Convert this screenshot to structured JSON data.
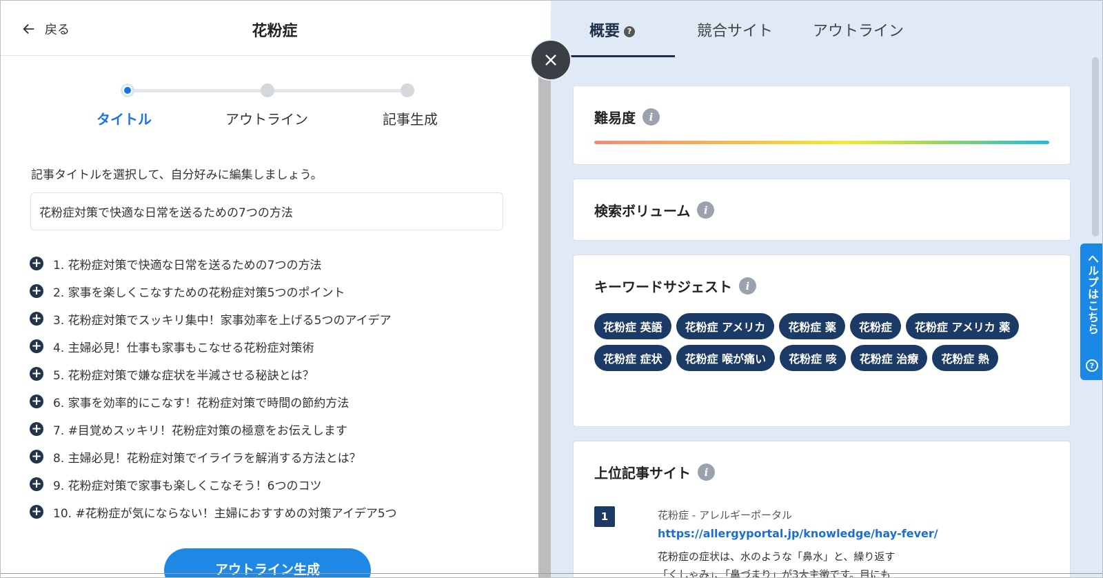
{
  "header": {
    "back_label": "戻る",
    "page_title": "花粉症"
  },
  "stepper": {
    "steps": [
      {
        "label": "タイトル",
        "active": true
      },
      {
        "label": "アウトライン",
        "active": false
      },
      {
        "label": "記事生成",
        "active": false
      }
    ]
  },
  "editor": {
    "instruction": "記事タイトルを選択して、自分好みに編集しましょう。",
    "title_value": "花粉症対策で快適な日常を送るための7つの方法",
    "suggestions": [
      "1. 花粉症対策で快適な日常を送るための7つの方法",
      "2. 家事を楽しくこなすための花粉症対策5つのポイント",
      "3. 花粉症対策でスッキリ集中！家事効率を上げる5つのアイデア",
      "4. 主婦必見！仕事も家事もこなせる花粉症対策術",
      "5. 花粉症対策で嫌な症状を半減させる秘訣とは？",
      "6. 家事を効率的にこなす！花粉症対策で時間の節約方法",
      "7. #目覚めスッキリ！花粉症対策の極意をお伝えします",
      "8. 主婦必見！花粉症対策でイライラを解消する方法とは？",
      "9. 花粉症対策で家事も楽しくこなそう！6つのコツ",
      "10. #花粉症が気にならない！主婦におすすめの対策アイデア5つ"
    ],
    "generate_button": "アウトライン生成"
  },
  "panel": {
    "tabs": [
      {
        "label": "概要",
        "active": true
      },
      {
        "label": "競合サイト",
        "active": false
      },
      {
        "label": "アウトライン",
        "active": false
      }
    ],
    "help_mark": "?",
    "info_mark": "i",
    "difficulty_title": "難易度",
    "volume_title": "検索ボリューム",
    "keyword_title": "キーワードサジェスト",
    "keywords": [
      "花粉症 英語",
      "花粉症 アメリカ",
      "花粉症 薬",
      "花粉症",
      "花粉症 アメリカ 薬",
      "花粉症 症状",
      "花粉症 喉が痛い",
      "花粉症 咳",
      "花粉症 治療",
      "花粉症 熱"
    ],
    "top_sites_title": "上位記事サイト",
    "top_sites": [
      {
        "rank": "1",
        "name": "花粉症 - アレルギーポータル",
        "url": "https://allergyportal.jp/knowledge/hay-fever/",
        "desc": "花粉症の症状は、水のような「鼻水」と、繰り返す「くしゃみ」、「鼻づまり」が3大主徴です。目にも"
      }
    ],
    "help_tab_label": "ヘルプはこちら"
  },
  "colors": {
    "accent_blue": "#1a73e8",
    "chip_navy": "#1b3a66",
    "panel_bg": "#dfeaf6",
    "button_blue": "#1e88e5"
  }
}
